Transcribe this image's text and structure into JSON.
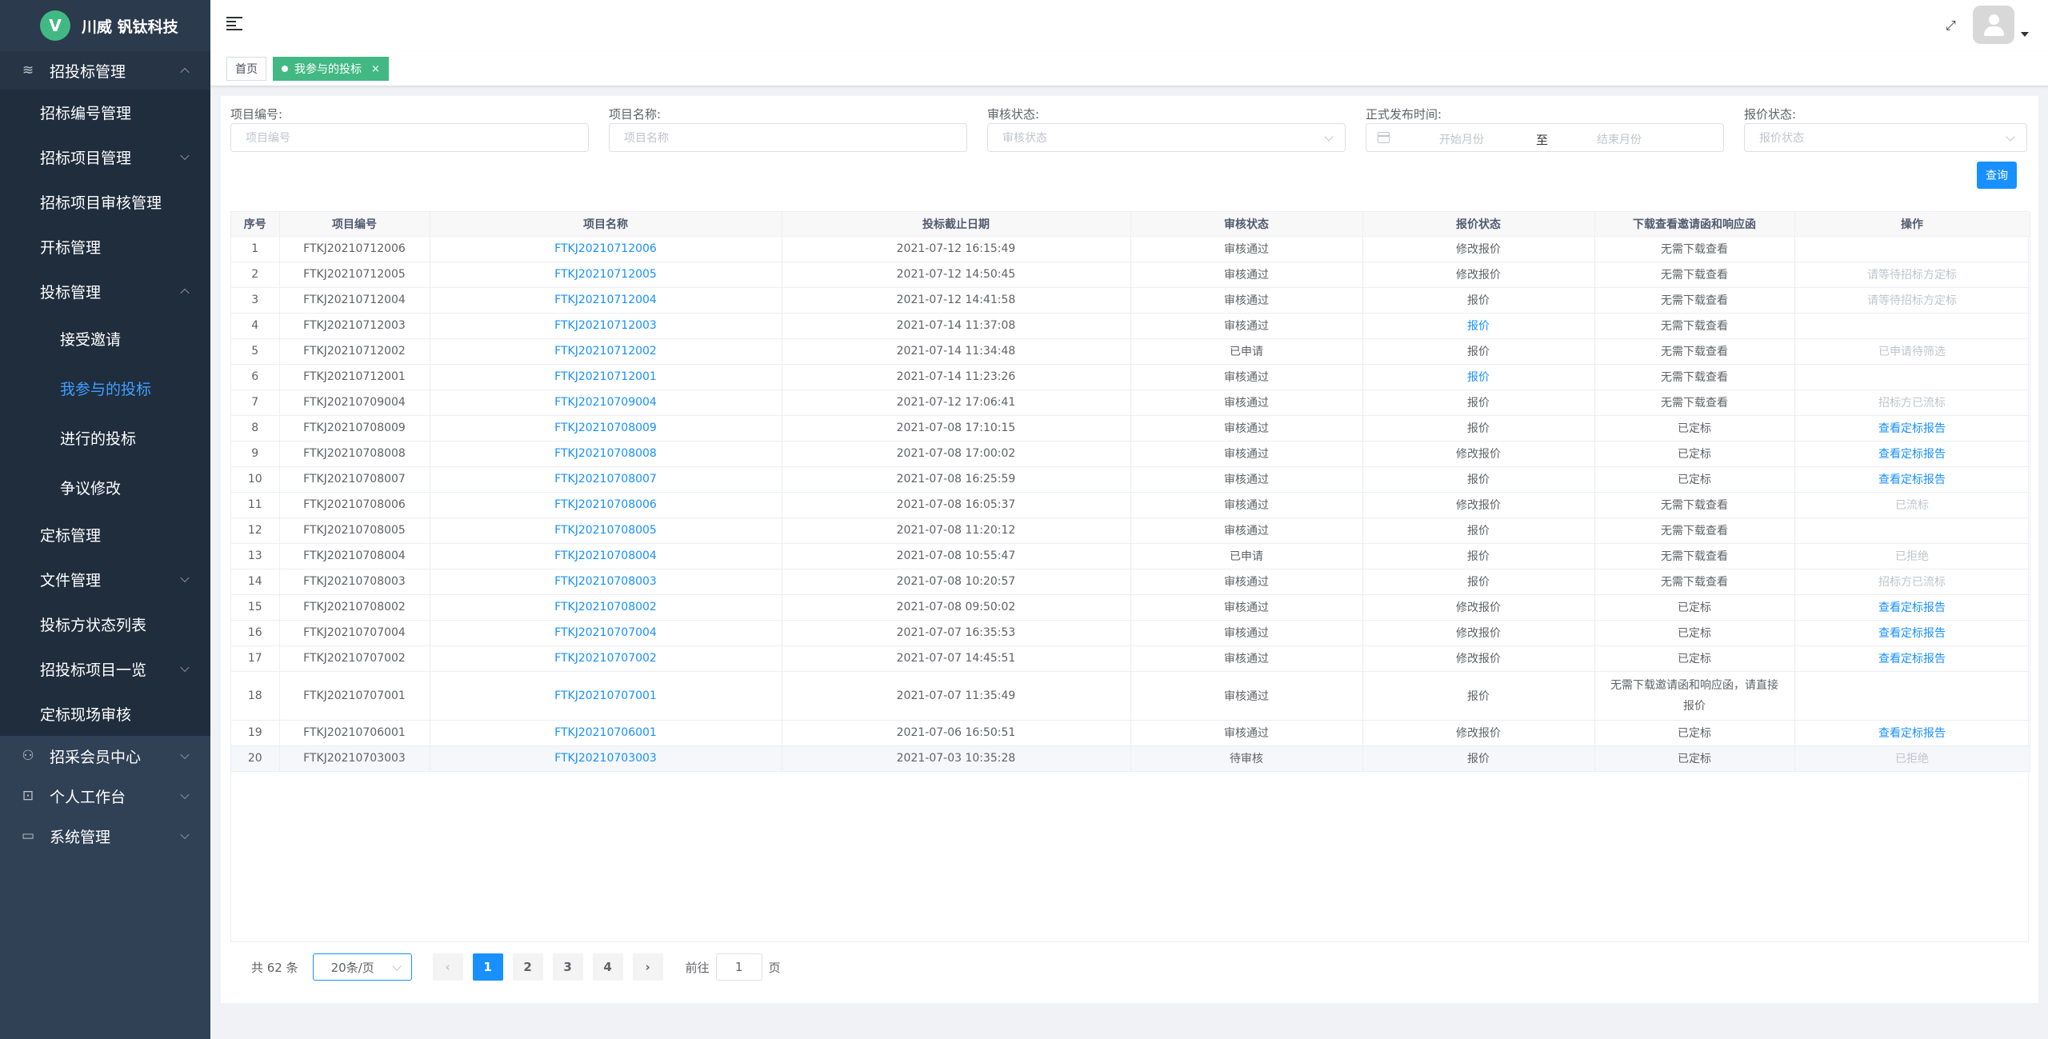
{
  "app": {
    "logo_letter": "V",
    "logo_text": "川威 钒钛科技"
  },
  "sidebar": {
    "groups": [
      {
        "label": "招投标管理",
        "icon": "layers-icon"
      },
      {
        "label": "招采会员中心",
        "icon": "users-icon"
      },
      {
        "label": "个人工作台",
        "icon": "chart-icon"
      },
      {
        "label": "系统管理",
        "icon": "monitor-icon"
      }
    ],
    "items": [
      {
        "label": "招标编号管理"
      },
      {
        "label": "招标项目管理"
      },
      {
        "label": "招标项目审核管理"
      },
      {
        "label": "开标管理"
      },
      {
        "label": "投标管理"
      },
      {
        "label": "接受邀请"
      },
      {
        "label": "我参与的投标"
      },
      {
        "label": "进行的投标"
      },
      {
        "label": "争议修改"
      },
      {
        "label": "定标管理"
      },
      {
        "label": "文件管理"
      },
      {
        "label": "投标方状态列表"
      },
      {
        "label": "招投标项目一览"
      },
      {
        "label": "定标现场审核"
      }
    ]
  },
  "tags": {
    "home": "首页",
    "current": "我参与的投标",
    "close": "×"
  },
  "filters": {
    "project_no_label": "项目编号:",
    "project_no_placeholder": "项目编号",
    "project_name_label": "项目名称:",
    "project_name_placeholder": "项目名称",
    "audit_label": "审核状态:",
    "audit_placeholder": "审核状态",
    "publish_label": "正式发布时间:",
    "start_placeholder": "开始月份",
    "range_sep": "至",
    "end_placeholder": "结束月份",
    "quote_label": "报价状态:",
    "quote_placeholder": "报价状态",
    "query_button": "查询"
  },
  "table": {
    "headers": [
      "序号",
      "项目编号",
      "项目名称",
      "投标截止日期",
      "审核状态",
      "报价状态",
      "下载查看邀请函和响应函",
      "操作"
    ],
    "rows": [
      [
        "1",
        "FTKJ20210712006",
        "FTKJ20210712006",
        "2021-07-12 16:15:49",
        "审核通过",
        "修改报价",
        "无需下载查看",
        ""
      ],
      [
        "2",
        "FTKJ20210712005",
        "FTKJ20210712005",
        "2021-07-12 14:50:45",
        "审核通过",
        "修改报价",
        "无需下载查看",
        "请等待招标方定标"
      ],
      [
        "3",
        "FTKJ20210712004",
        "FTKJ20210712004",
        "2021-07-12 14:41:58",
        "审核通过",
        "报价",
        "无需下载查看",
        "请等待招标方定标"
      ],
      [
        "4",
        "FTKJ20210712003",
        "FTKJ20210712003",
        "2021-07-14 11:37:08",
        "审核通过",
        "报价",
        "无需下载查看",
        ""
      ],
      [
        "5",
        "FTKJ20210712002",
        "FTKJ20210712002",
        "2021-07-14 11:34:48",
        "已申请",
        "报价",
        "无需下载查看",
        "已申请待筛选"
      ],
      [
        "6",
        "FTKJ20210712001",
        "FTKJ20210712001",
        "2021-07-14 11:23:26",
        "审核通过",
        "报价",
        "无需下载查看",
        ""
      ],
      [
        "7",
        "FTKJ20210709004",
        "FTKJ20210709004",
        "2021-07-12 17:06:41",
        "审核通过",
        "报价",
        "无需下载查看",
        "招标方已流标"
      ],
      [
        "8",
        "FTKJ20210708009",
        "FTKJ20210708009",
        "2021-07-08 17:10:15",
        "审核通过",
        "报价",
        "已定标",
        "查看定标报告"
      ],
      [
        "9",
        "FTKJ20210708008",
        "FTKJ20210708008",
        "2021-07-08 17:00:02",
        "审核通过",
        "修改报价",
        "已定标",
        "查看定标报告"
      ],
      [
        "10",
        "FTKJ20210708007",
        "FTKJ20210708007",
        "2021-07-08 16:25:59",
        "审核通过",
        "报价",
        "已定标",
        "查看定标报告"
      ],
      [
        "11",
        "FTKJ20210708006",
        "FTKJ20210708006",
        "2021-07-08 16:05:37",
        "审核通过",
        "修改报价",
        "无需下载查看",
        "已流标"
      ],
      [
        "12",
        "FTKJ20210708005",
        "FTKJ20210708005",
        "2021-07-08 11:20:12",
        "审核通过",
        "报价",
        "无需下载查看",
        ""
      ],
      [
        "13",
        "FTKJ20210708004",
        "FTKJ20210708004",
        "2021-07-08 10:55:47",
        "已申请",
        "报价",
        "无需下载查看",
        "已拒绝"
      ],
      [
        "14",
        "FTKJ20210708003",
        "FTKJ20210708003",
        "2021-07-08 10:20:57",
        "审核通过",
        "报价",
        "无需下载查看",
        "招标方已流标"
      ],
      [
        "15",
        "FTKJ20210708002",
        "FTKJ20210708002",
        "2021-07-08 09:50:02",
        "审核通过",
        "修改报价",
        "已定标",
        "查看定标报告"
      ],
      [
        "16",
        "FTKJ20210707004",
        "FTKJ20210707004",
        "2021-07-07 16:35:53",
        "审核通过",
        "修改报价",
        "已定标",
        "查看定标报告"
      ],
      [
        "17",
        "FTKJ20210707002",
        "FTKJ20210707002",
        "2021-07-07 14:45:51",
        "审核通过",
        "修改报价",
        "已定标",
        "查看定标报告"
      ],
      [
        "18",
        "FTKJ20210707001",
        "FTKJ20210707001",
        "2021-07-07 11:35:49",
        "审核通过",
        "报价",
        "无需下载邀请函和响应函，请直接报价",
        ""
      ],
      [
        "19",
        "FTKJ20210706001",
        "FTKJ20210706001",
        "2021-07-06 16:50:51",
        "审核通过",
        "修改报价",
        "已定标",
        "查看定标报告"
      ],
      [
        "20",
        "FTKJ20210703003",
        "FTKJ20210703003",
        "2021-07-03 10:35:28",
        "待审核",
        "报价",
        "已定标",
        "已拒绝"
      ]
    ]
  },
  "pagination": {
    "total": "共 62 条",
    "page_size": "20条/页",
    "prev": "‹",
    "next": "›",
    "pages": [
      "1",
      "2",
      "3",
      "4"
    ],
    "current": "1",
    "goto_label": "前往",
    "goto_value": "1",
    "goto_suffix": "页"
  },
  "colors": {
    "sidebar_bg": "#304156",
    "accent": "#1890ff",
    "tag_active": "#42b983"
  }
}
